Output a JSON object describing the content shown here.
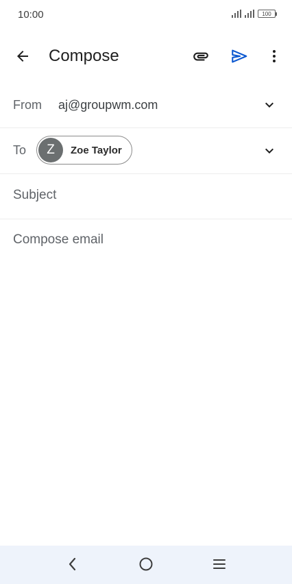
{
  "status_bar": {
    "time": "10:00",
    "battery": "100",
    "icons": [
      "signal-icon",
      "signal-icon",
      "battery-icon"
    ]
  },
  "app_bar": {
    "title": "Compose",
    "icons": [
      "back-arrow-icon",
      "attachment-icon",
      "send-icon",
      "more-vert-icon"
    ],
    "send_color": "#0b57d0"
  },
  "from": {
    "label": "From",
    "value": "aj@groupwm.com"
  },
  "to": {
    "label": "To",
    "recipient": {
      "initial": "Z",
      "name": "Zoe Taylor"
    }
  },
  "subject": {
    "placeholder": "Subject"
  },
  "body": {
    "placeholder": "Compose email"
  },
  "nav_bar": {
    "icons": [
      "nav-back-icon",
      "nav-home-icon",
      "nav-menu-icon"
    ]
  }
}
